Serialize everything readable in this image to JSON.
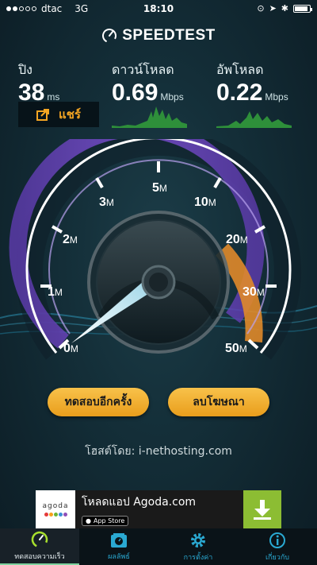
{
  "status_bar": {
    "carrier": "dtac",
    "network": "3G",
    "time": "18:10"
  },
  "app": {
    "name": "SPEEDTEST"
  },
  "metrics": {
    "ping": {
      "label": "ปิง",
      "value": "38",
      "unit": "ms"
    },
    "download": {
      "label": "ดาวน์โหลด",
      "value": "0.69",
      "unit": "Mbps"
    },
    "upload": {
      "label": "อัพโหลด",
      "value": "0.22",
      "unit": "Mbps"
    }
  },
  "share": {
    "label": "แชร์"
  },
  "gauge": {
    "ticks": [
      {
        "num": "0",
        "unit": "M"
      },
      {
        "num": "1",
        "unit": "M"
      },
      {
        "num": "2",
        "unit": "M"
      },
      {
        "num": "3",
        "unit": "M"
      },
      {
        "num": "5",
        "unit": "M"
      },
      {
        "num": "10",
        "unit": "M"
      },
      {
        "num": "20",
        "unit": "M"
      },
      {
        "num": "30",
        "unit": "M"
      },
      {
        "num": "50",
        "unit": "M"
      }
    ]
  },
  "buttons": {
    "retest": "ทดสอบอีกครั้ง",
    "remove_ads": "ลบโฆษณา"
  },
  "host": {
    "label": "โฮสต์โดย:",
    "name": "i-nethosting.com"
  },
  "ad": {
    "logo_text": "agoda",
    "title": "โหลดแอป Agoda.com",
    "store_badge": "App Store"
  },
  "tabs": [
    {
      "label": "ทดสอบความเร็ว",
      "icon": "speedometer-icon",
      "active": true
    },
    {
      "label": "ผลลัพธ์",
      "icon": "results-icon",
      "active": false
    },
    {
      "label": "การตั้งค่า",
      "icon": "gear-icon",
      "active": false
    },
    {
      "label": "เกี่ยวกับ",
      "icon": "info-icon",
      "active": false
    }
  ],
  "colors": {
    "accent": "#f5a623",
    "tab_blue": "#2aa9d2",
    "gauge_purple": "#8a5cd6",
    "ad_green": "#8cbd33"
  }
}
